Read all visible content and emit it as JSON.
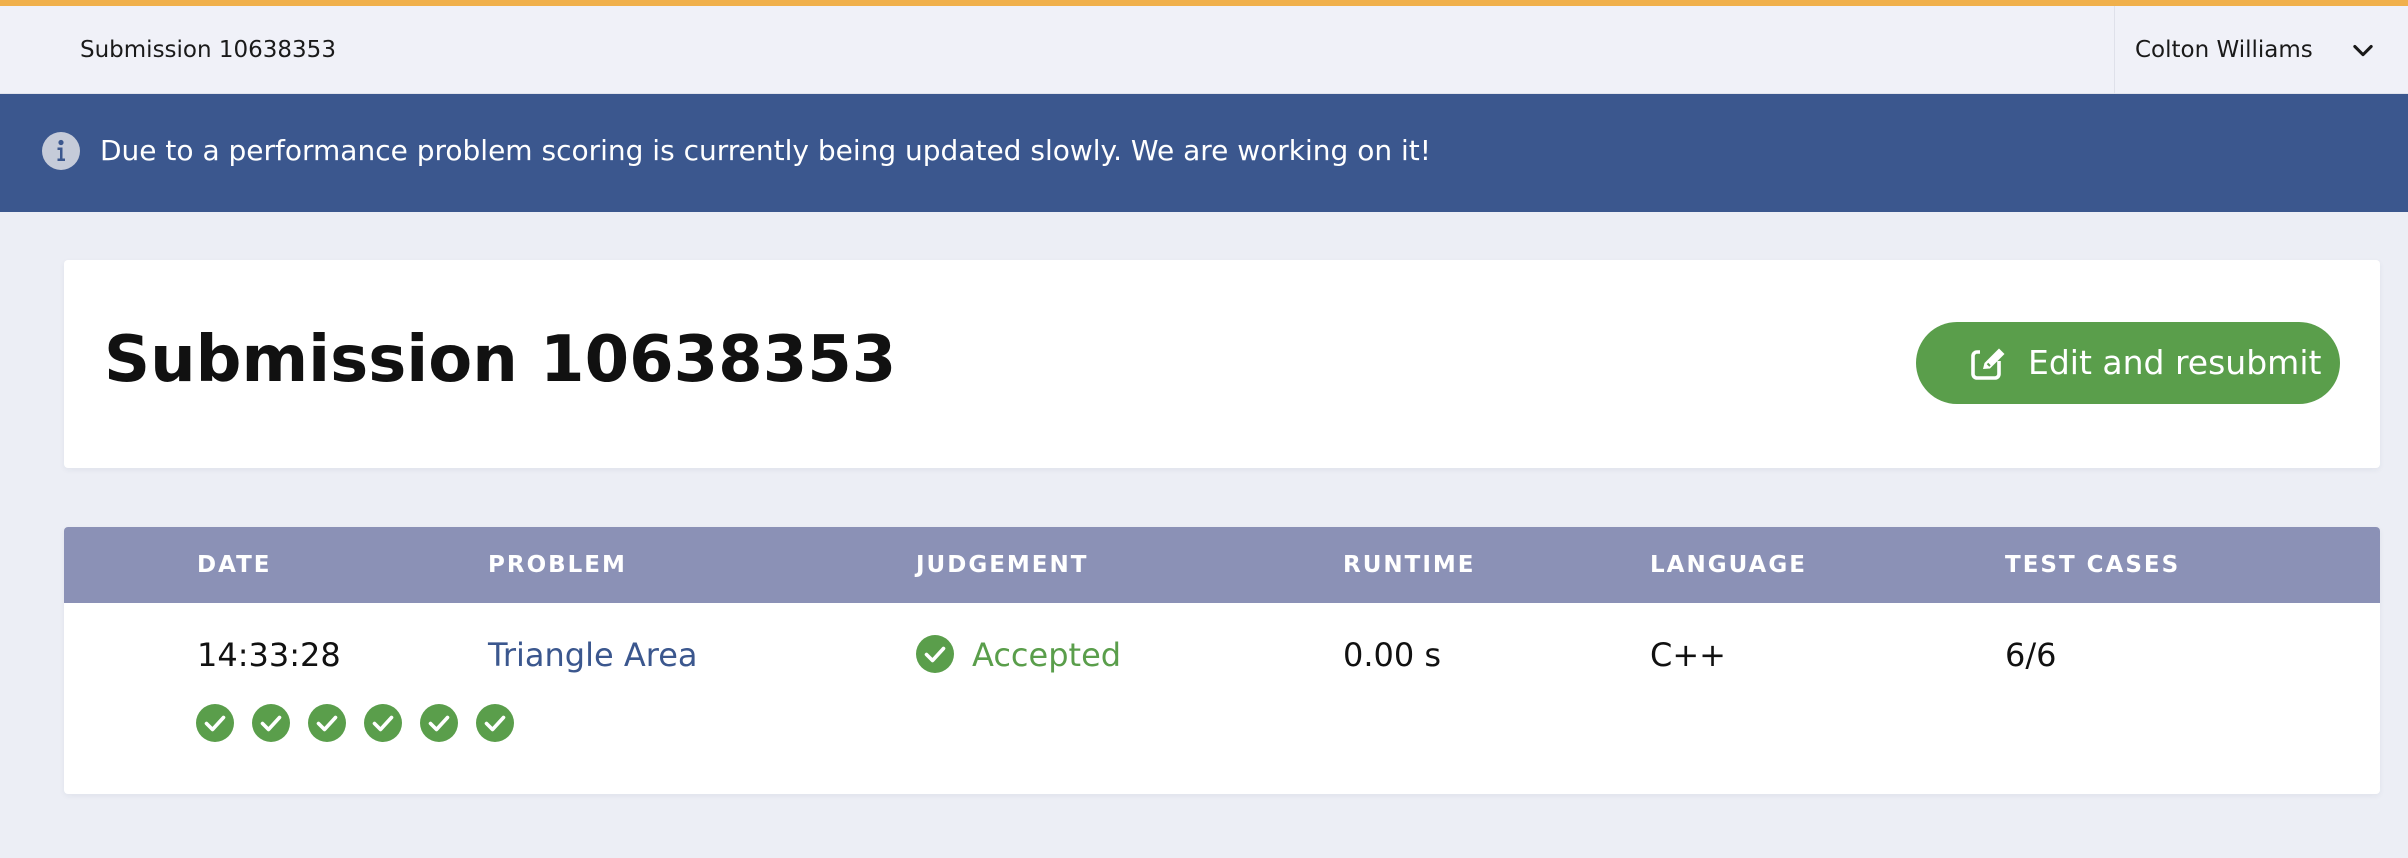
{
  "colors": {
    "accent": "#f0b04c",
    "banner": "#3b578e",
    "success": "#5a9e4b",
    "table_header": "#8b91b6",
    "link": "#3b578e"
  },
  "topbar": {
    "title": "Submission 10638353",
    "user_name": "Colton Williams",
    "user_menu_icon": "chevron-down-icon"
  },
  "banner": {
    "icon": "info-icon",
    "message": "Due to a performance problem scoring is currently being updated slowly. We are working on it!"
  },
  "header": {
    "title": "Submission 10638353",
    "resubmit_label": "Edit and resubmit",
    "resubmit_icon": "edit-icon"
  },
  "table": {
    "columns": [
      "DATE",
      "PROBLEM",
      "JUDGEMENT",
      "RUNTIME",
      "LANGUAGE",
      "TEST CASES"
    ],
    "row": {
      "date": "14:33:28",
      "problem": "Triangle Area",
      "judgement": "Accepted",
      "judgement_icon": "check-circle-icon",
      "runtime": "0.00 s",
      "language": "C++",
      "test_cases": "6/6"
    },
    "test_case_results": [
      "passed",
      "passed",
      "passed",
      "passed",
      "passed",
      "passed"
    ]
  }
}
